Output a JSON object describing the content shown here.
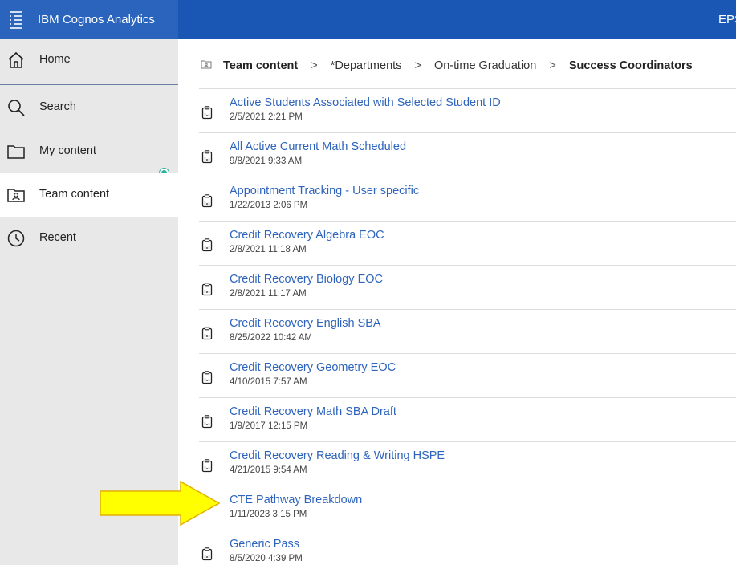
{
  "header": {
    "app_title": "IBM Cognos Analytics",
    "user_code": "EPS",
    "colors": {
      "bar": "#1a57b5",
      "side_bar": "#2a64bd"
    }
  },
  "sidebar": {
    "items": [
      {
        "label": "Home",
        "icon": "home-icon"
      },
      {
        "label": "Search",
        "icon": "search-icon"
      },
      {
        "label": "My content",
        "icon": "folder-icon"
      },
      {
        "label": "Team content",
        "icon": "team-folder-icon",
        "active": true
      },
      {
        "label": "Recent",
        "icon": "clock-icon"
      }
    ]
  },
  "breadcrumb": {
    "items": [
      "Team content",
      "*Departments",
      "On-time Graduation",
      "Success Coordinators"
    ],
    "separator": ">"
  },
  "list": {
    "rows": [
      {
        "title": "Active Students Associated with Selected Student ID",
        "date": "2/5/2021 2:21 PM",
        "icon": "report-icon"
      },
      {
        "title": "All Active Current Math Scheduled",
        "date": "9/8/2021 9:33 AM",
        "icon": "report-icon"
      },
      {
        "title": "Appointment Tracking - User specific",
        "date": "1/22/2013 2:06 PM",
        "icon": "report-icon"
      },
      {
        "title": "Credit Recovery Algebra EOC",
        "date": "2/8/2021 11:18 AM",
        "icon": "report-icon"
      },
      {
        "title": "Credit Recovery Biology EOC",
        "date": "2/8/2021 11:17 AM",
        "icon": "report-icon"
      },
      {
        "title": "Credit Recovery English SBA",
        "date": "8/25/2022 10:42 AM",
        "icon": "report-icon"
      },
      {
        "title": "Credit Recovery Geometry EOC",
        "date": "4/10/2015 7:57 AM",
        "icon": "report-icon"
      },
      {
        "title": "Credit Recovery Math SBA Draft",
        "date": "1/9/2017 12:15 PM",
        "icon": "report-icon"
      },
      {
        "title": "Credit Recovery Reading & Writing HSPE",
        "date": "4/21/2015 9:54 AM",
        "icon": "report-icon"
      },
      {
        "title": "CTE Pathway Breakdown",
        "date": "1/11/2023 3:15 PM",
        "icon": "report-icon",
        "highlighted": true
      },
      {
        "title": "Generic Pass",
        "date": "8/5/2020 4:39 PM",
        "icon": "report-icon"
      }
    ],
    "link_color": "#2e64bc"
  },
  "annotation": {
    "type": "arrow",
    "color": "#ffff00",
    "outline": "#e0b000",
    "points_to": "CTE Pathway Breakdown"
  }
}
